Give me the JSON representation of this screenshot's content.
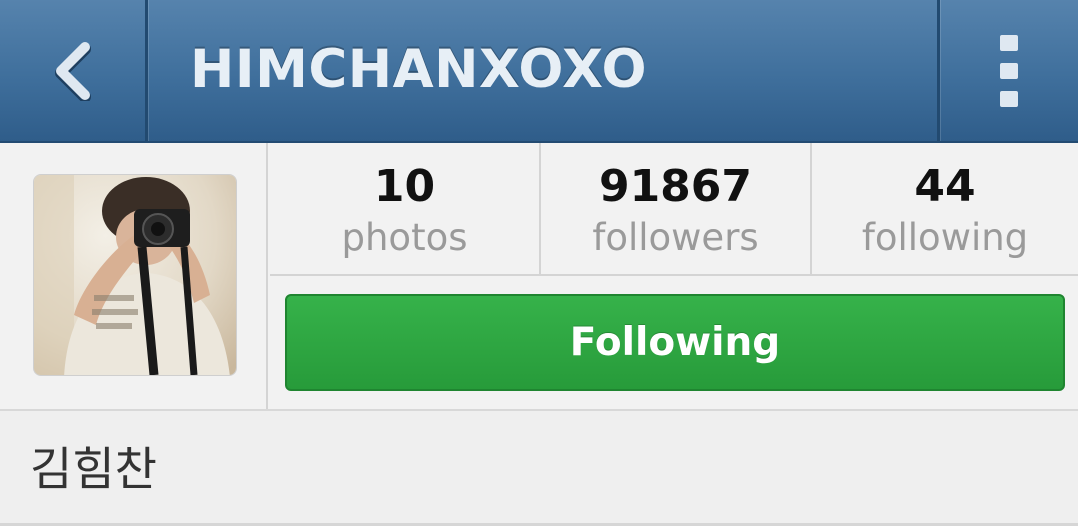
{
  "header": {
    "title": "HIMCHANXOXO",
    "back_icon": "chevron-left-icon",
    "menu_icon": "vertical-dots-icon",
    "bar_color": "#3f6f9c"
  },
  "profile": {
    "avatar_alt": "profile photo",
    "stats": [
      {
        "value": "10",
        "label": "photos"
      },
      {
        "value": "91867",
        "label": "followers"
      },
      {
        "value": "44",
        "label": "following"
      }
    ],
    "follow_button_label": "Following",
    "follow_button_color": "#2fa843"
  },
  "bio": {
    "full_name": "김힘찬"
  }
}
